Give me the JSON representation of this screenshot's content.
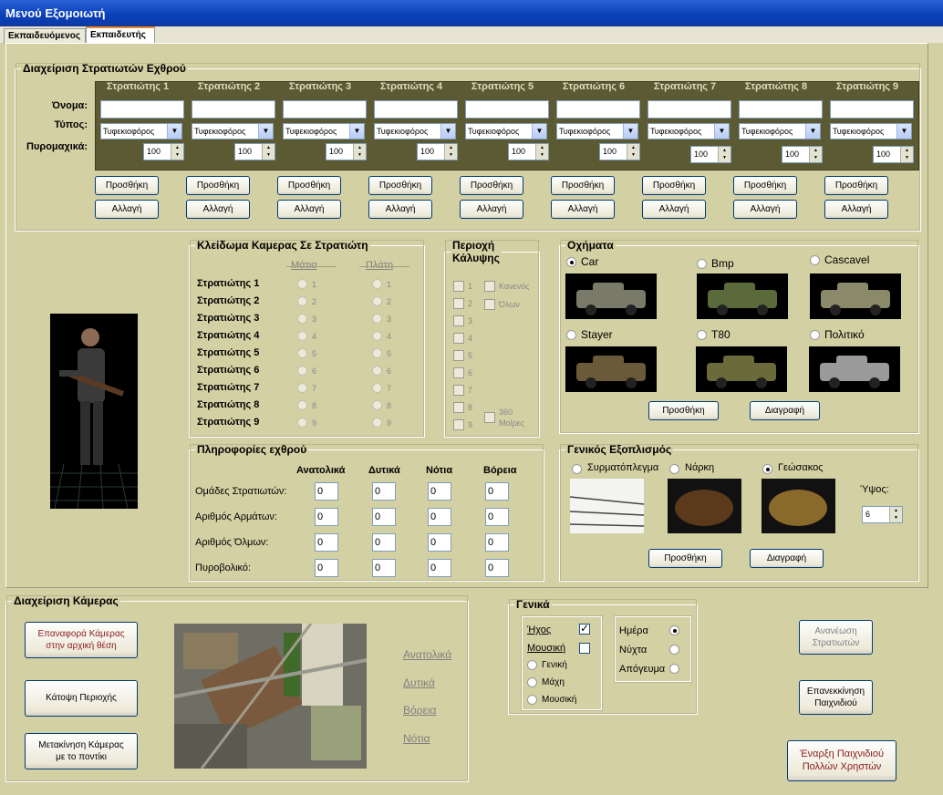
{
  "window": {
    "title": "Μενού Εξομοιωτή"
  },
  "tabs": [
    "Εκπαιδευόμενος",
    "Εκπαιδευτής"
  ],
  "soldiers": {
    "title": "Διαχείριση Στρατιωτών Εχθρού",
    "columns": [
      "Στρατιώτης 1",
      "Στρατιώτης 2",
      "Στρατιώτης 3",
      "Στρατιώτης 4",
      "Στρατιώτης 5",
      "Στρατιώτης 6",
      "Στρατιώτης 7",
      "Στρατιώτης 8",
      "Στρατιώτης 9"
    ],
    "labels": {
      "name": "Όνομα:",
      "type": "Τύπος:",
      "ammo": "Πυρομαχικά:"
    },
    "type_value": "Τυφεκιοφόρος",
    "ammo_value": "100",
    "add": "Προσθήκη",
    "change": "Αλλαγή"
  },
  "camera_lock": {
    "title": "Κλείδωμα Καμερας Σε Στρατιώτη",
    "eyes": "Μάτια",
    "back": "Πλάτη",
    "rows": [
      "Στρατιώτης 1",
      "Στρατιώτης 2",
      "Στρατιώτης 3",
      "Στρατιώτης 4",
      "Στρατιώτης 5",
      "Στρατιώτης 6",
      "Στρατιώτης 7",
      "Στρατιώτης 8",
      "Στρατιώτης 9"
    ],
    "nums": [
      "1",
      "2",
      "3",
      "4",
      "5",
      "6",
      "7",
      "8",
      "9"
    ]
  },
  "coverage": {
    "title1": "Περιοχή",
    "title2": "Κάλυψης",
    "nums": [
      "1",
      "2",
      "3",
      "4",
      "5",
      "6",
      "7",
      "8",
      "9"
    ],
    "none": "Κανενός",
    "all": "Όλων",
    "deg1": "360",
    "deg2": "Μοίρες"
  },
  "vehicles": {
    "title": "Οχήματα",
    "items": [
      "Car",
      "Bmp",
      "Cascavel",
      "Stayer",
      "T80",
      "Πολιτικό"
    ],
    "add": "Προσθήκη",
    "delete": "Διαγραφή"
  },
  "enemy_info": {
    "title": "Πληροφορίες εχθρού",
    "dirs": [
      "Ανατολικά",
      "Δυτικά",
      "Νότια",
      "Βόρεια"
    ],
    "rows": [
      {
        "label": "Ομάδες Στρατιωτών:",
        "vals": [
          "0",
          "0",
          "0",
          "0"
        ]
      },
      {
        "label": "Αριθμός Αρμάτων:",
        "vals": [
          "0",
          "0",
          "0",
          "0"
        ]
      },
      {
        "label": "Αριθμός Όλμων:",
        "vals": [
          "0",
          "0",
          "0",
          "0"
        ]
      },
      {
        "label": "Πυροβολικό:",
        "vals": [
          "0",
          "0",
          "0",
          "0"
        ]
      }
    ]
  },
  "equipment": {
    "title": "Γενικός Εξοπλισμός",
    "items": [
      "Συρματόπλεγμα",
      "Νάρκη",
      "Γεώσακος"
    ],
    "height_label": "Ύψος:",
    "height_value": "6",
    "add": "Προσθήκη",
    "delete": "Διαγραφή"
  },
  "camera": {
    "title": "Διαχείριση Κάμερας",
    "reset1": "Επαναφορά Κάμερας",
    "reset2": "στην αρχική θέση",
    "top": "Κάτοψη Περιοχής",
    "move1": "Μετακίνηση Κάμερας",
    "move2": "με το ποντίκι",
    "links": [
      "Ανατολικά",
      "Δυτικά",
      "Βόρεια",
      "Νότια"
    ]
  },
  "general": {
    "title": "Γενικά",
    "sound": "Ήχος",
    "music": "Μουσική",
    "music_opts": [
      "Γενική",
      "Μάχη",
      "Μουσική"
    ],
    "times": [
      "Ημέρα",
      "Νύχτα",
      "Απόγευμα"
    ]
  },
  "actions": {
    "refresh1": "Ανανέωση",
    "refresh2": "Στρατιωτών",
    "restart1": "Επανεκκίνηση",
    "restart2": "Παιχνιδιού",
    "start1": "Έναρξη Παιχνιδιού",
    "start2": "Πολλών Χρηστών"
  },
  "colors": {
    "accent_red": "#8b1a1a",
    "titlebar": "#0a3fb8",
    "panel": "#d3d0a3"
  }
}
